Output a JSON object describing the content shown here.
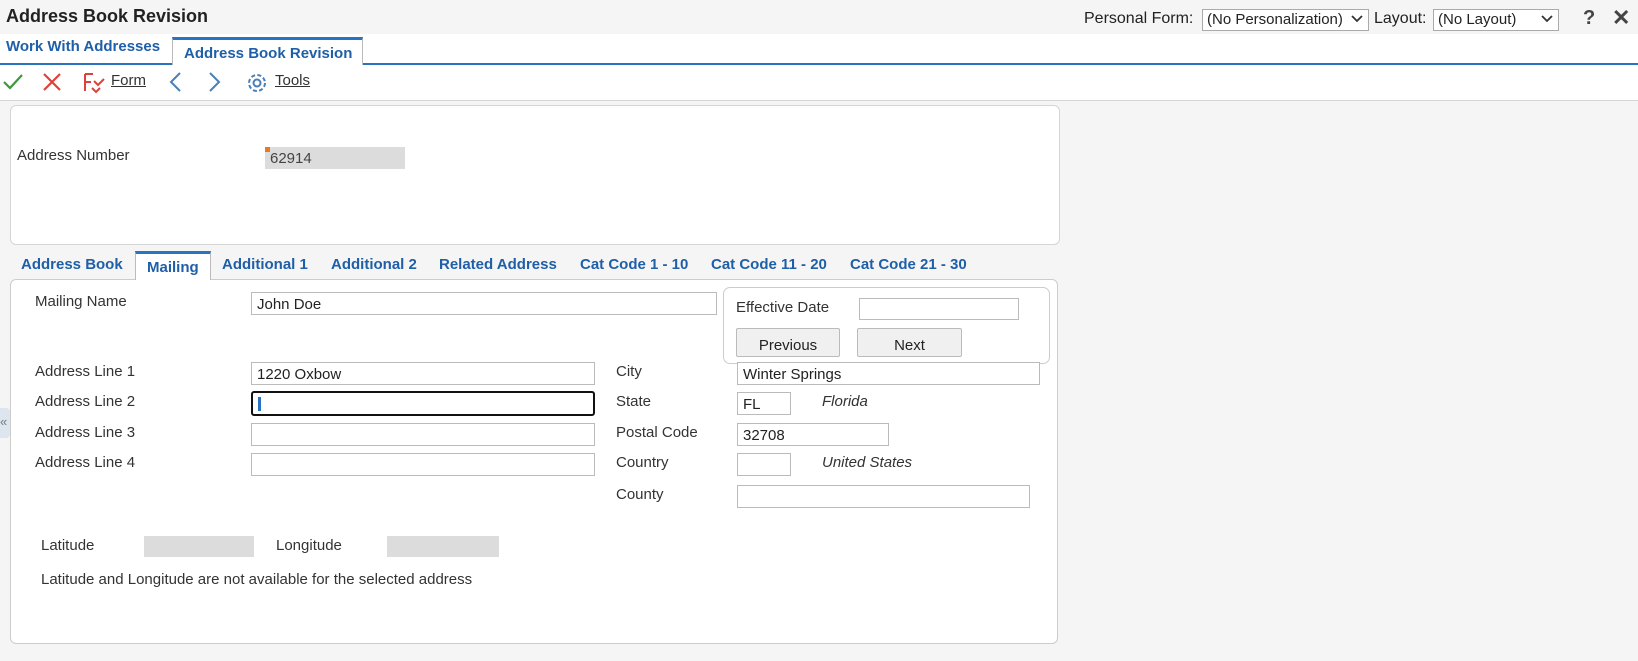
{
  "window": {
    "title": "Address Book Revision",
    "personal_form_label": "Personal Form:",
    "personal_form_value": "(No Personalization)",
    "layout_label": "Layout:",
    "layout_value": "(No Layout)",
    "help_glyph": "?",
    "close_glyph": "✕"
  },
  "app_tabs": [
    {
      "label": "Work With Addresses",
      "active": false
    },
    {
      "label": "Address Book Revision",
      "active": true
    }
  ],
  "toolbar": {
    "form_label": "Form",
    "tools_label": "Tools",
    "icons": [
      "ok-checkmark-icon",
      "cancel-x-icon",
      "form-menu-icon",
      "previous-arrow-icon",
      "next-arrow-icon",
      "gear-icon"
    ]
  },
  "header": {
    "address_number_label": "Address Number",
    "address_number_value": "62914"
  },
  "form_tabs": [
    {
      "label": "Address Book",
      "active": false
    },
    {
      "label": "Mailing",
      "active": true
    },
    {
      "label": "Additional 1",
      "active": false
    },
    {
      "label": "Additional 2",
      "active": false
    },
    {
      "label": "Related Address",
      "active": false
    },
    {
      "label": "Cat Code 1 - 10",
      "active": false
    },
    {
      "label": "Cat Code 11 - 20",
      "active": false
    },
    {
      "label": "Cat Code 21 - 30",
      "active": false
    }
  ],
  "mailing": {
    "mailing_name_label": "Mailing Name",
    "mailing_name_value": "John Doe",
    "effective_date_label": "Effective Date",
    "effective_date_value": "",
    "previous_button": "Previous",
    "next_button": "Next",
    "address_line_1_label": "Address Line 1",
    "address_line_1_value": "1220 Oxbow",
    "address_line_2_label": "Address Line 2",
    "address_line_2_value": "",
    "address_line_3_label": "Address Line 3",
    "address_line_3_value": "",
    "address_line_4_label": "Address Line 4",
    "address_line_4_value": "",
    "city_label": "City",
    "city_value": "Winter Springs",
    "state_label": "State",
    "state_value": "FL",
    "state_description": "Florida",
    "postal_code_label": "Postal Code",
    "postal_code_value": "32708",
    "country_label": "Country",
    "country_value": "",
    "country_description": "United States",
    "county_label": "County",
    "county_value": "",
    "latitude_label": "Latitude",
    "latitude_value": "",
    "longitude_label": "Longitude",
    "longitude_value": "",
    "lat_long_note": "Latitude and Longitude are not available for the selected address"
  },
  "colors": {
    "accent_blue": "#2a73c0",
    "link_blue": "#1f5fa8",
    "required_orange": "#e87b1e",
    "ok_green": "#3a9a3a",
    "cancel_red": "#e0403a"
  }
}
